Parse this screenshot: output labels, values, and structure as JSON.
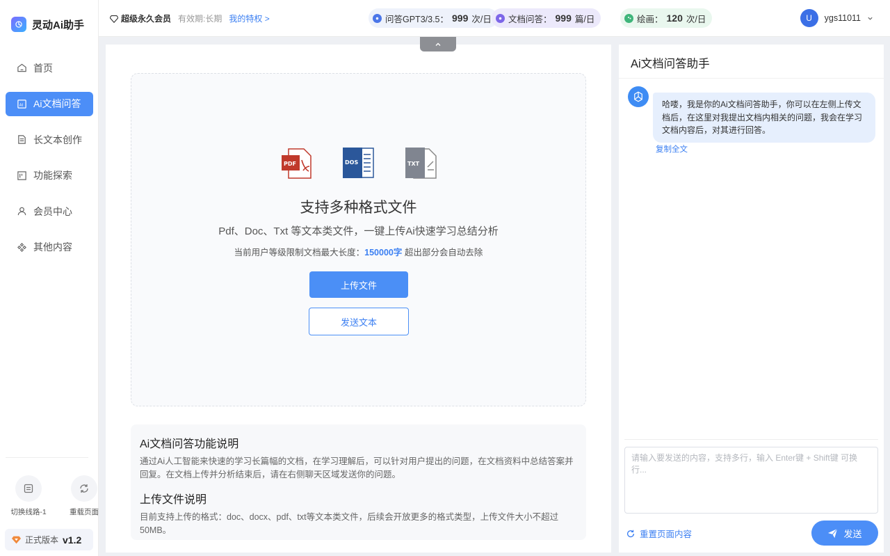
{
  "app": {
    "title": "灵动Ai助手"
  },
  "sidebar": {
    "items": [
      {
        "label": "首页",
        "icon": "home-icon"
      },
      {
        "label": "Ai文档问答",
        "icon": "ai-doc-icon"
      },
      {
        "label": "长文本创作",
        "icon": "document-icon"
      },
      {
        "label": "功能探索",
        "icon": "explore-icon"
      },
      {
        "label": "会员中心",
        "icon": "user-icon"
      },
      {
        "label": "其他内容",
        "icon": "more-icon"
      }
    ],
    "tools": [
      {
        "label": "切换线路-1",
        "icon": "switch-line-icon"
      },
      {
        "label": "重载页面",
        "icon": "refresh-icon"
      }
    ],
    "version_label": "正式版本",
    "version": "v1.2"
  },
  "header": {
    "member_title": "超级永久会员",
    "validity": "有效期:长期",
    "privileges_link": "我的特权 >",
    "quotas": [
      {
        "label": "问答GPT3/3.5：",
        "value": "999",
        "unit": "次/日"
      },
      {
        "label": "文档问答：",
        "value": "999",
        "unit": "篇/日"
      },
      {
        "label": "绘画：",
        "value": "120",
        "unit": "次/日"
      }
    ],
    "user": {
      "avatar_letter": "U",
      "name": "ygs11011"
    }
  },
  "upload": {
    "file_types": [
      "PDF",
      "DOS",
      "TXT"
    ],
    "title": "支持多种格式文件",
    "description": "Pdf、Doc、Txt 等文本类文件，一键上传Ai快速学习总结分析",
    "limit_prefix": "当前用户等级限制文档最大长度：",
    "limit_value": "150000字",
    "limit_suffix": " 超出部分会自动去除",
    "upload_button": "上传文件",
    "send_text_button": "发送文本"
  },
  "info": {
    "section1_title": "Ai文档问答功能说明",
    "section1_text": "通过Ai人工智能来快速的学习长篇幅的文档，在学习理解后，可以针对用户提出的问题，在文档资料中总结答案并回复。在文档上传并分析结束后，请在右侧聊天区域发送你的问题。",
    "section2_title": "上传文件说明",
    "section2_text": "目前支持上传的格式：doc、docx、pdf、txt等文本类文件，后续会开放更多的格式类型，上传文件大小不超过50MB。"
  },
  "chat": {
    "title": "Ai文档问答助手",
    "message": "哈喽，我是你的Ai文档问答助手，你可以在左侧上传文档后，在这里对我提出文档内相关的问题，我会在学习文档内容后，对其进行回答。",
    "copy_label": "复制全文",
    "input_placeholder": "请输入要发送的内容，支持多行，输入 Enter键 + Shift键 可换行...",
    "reset_label": "重置页面内容",
    "send_label": "发送"
  }
}
